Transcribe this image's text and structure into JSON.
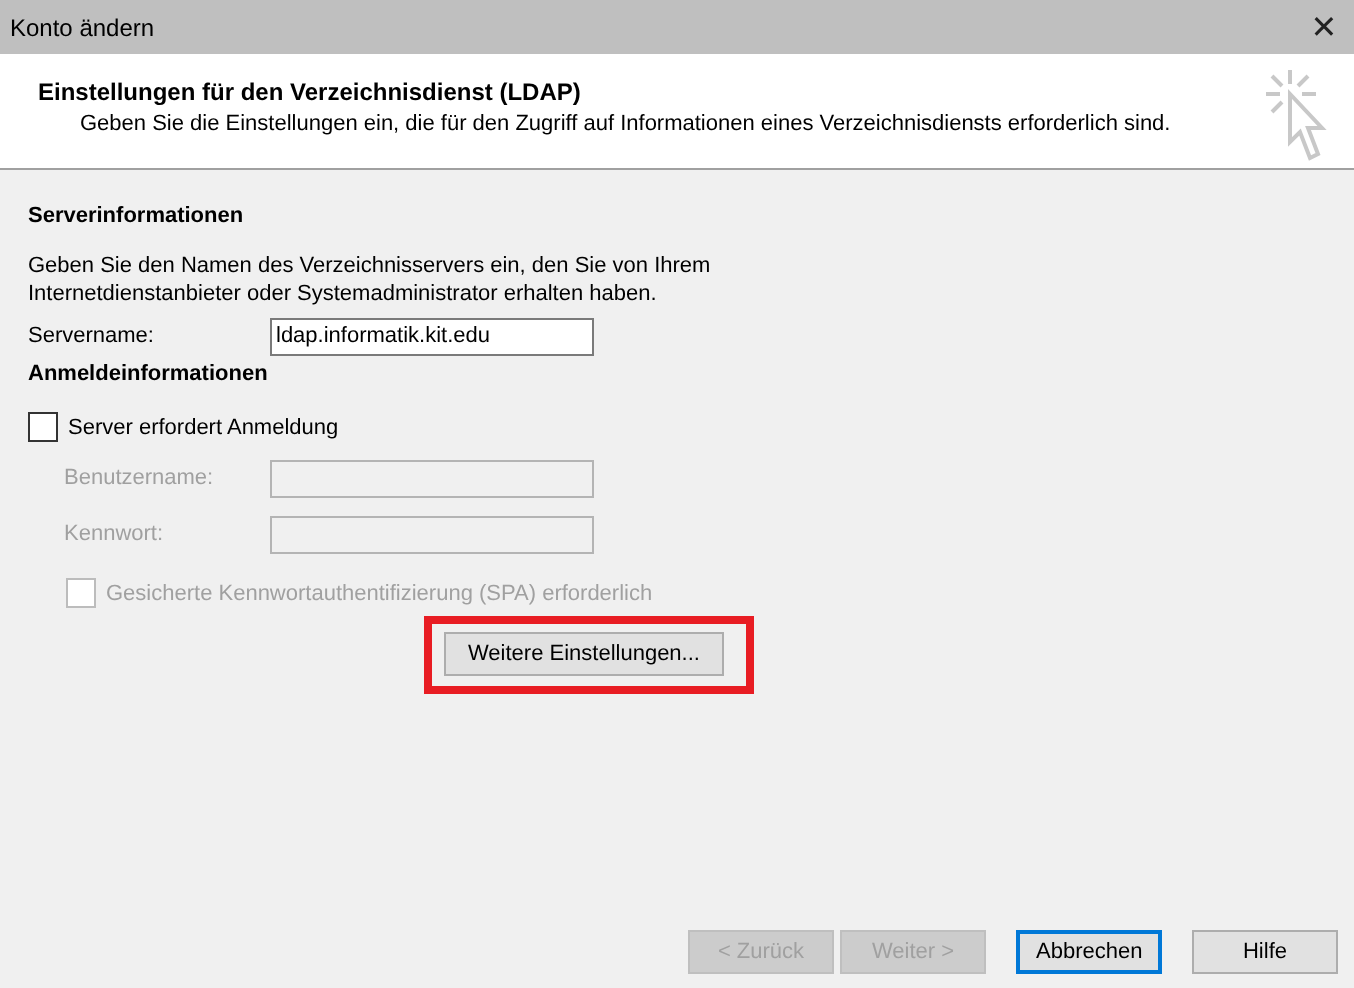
{
  "window": {
    "title": "Konto ändern",
    "close": "✕"
  },
  "header": {
    "title": "Einstellungen für den Verzeichnisdienst (LDAP)",
    "subtitle": "Geben Sie die Einstellungen ein, die für den Zugriff auf Informationen eines Verzeichnisdiensts erforderlich sind."
  },
  "server_info": {
    "heading": "Serverinformationen",
    "description": "Geben Sie den Namen des Verzeichnisservers ein, den Sie von Ihrem Internetdienstanbieter oder Systemadministrator erhalten haben.",
    "label": "Servername:",
    "value": "ldap.informatik.kit.edu"
  },
  "login_info": {
    "heading": "Anmeldeinformationen",
    "requires_login": {
      "label": "Server erfordert Anmeldung",
      "checked": false
    },
    "fields": [
      {
        "label": "Benutzername:",
        "disabled": true
      },
      {
        "label": "Kennwort:",
        "disabled": true
      }
    ],
    "spa": {
      "label": "Gesicherte Kennwortauthentifizierung (SPA) erforderlich",
      "checked": false,
      "disabled": true
    },
    "more_settings": {
      "label": "Weitere Einstellungen...",
      "highlighted": true
    }
  },
  "buttons": [
    {
      "label": "< Zurück",
      "disabled": true,
      "focused": false
    },
    {
      "label": "Weiter >",
      "disabled": true,
      "focused": false
    },
    {
      "label": "Abbrechen",
      "disabled": false,
      "focused": true
    },
    {
      "label": "Hilfe",
      "disabled": false,
      "focused": false
    }
  ]
}
